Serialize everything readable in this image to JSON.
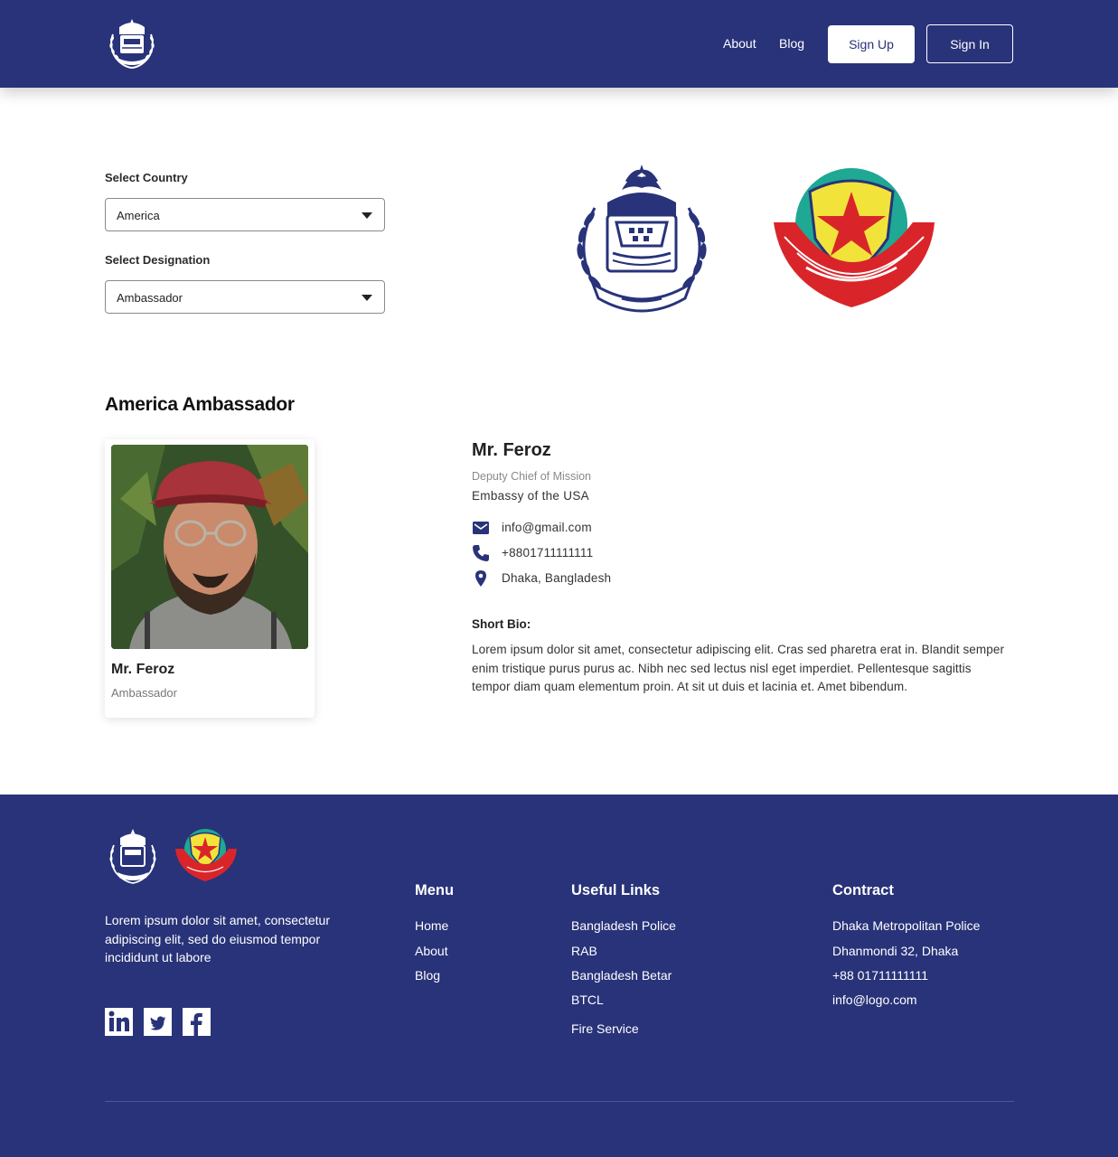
{
  "header": {
    "logo": "bangladesh-police-emblem",
    "nav": {
      "about": "About",
      "blog": "Blog"
    },
    "signup_label": "Sign Up",
    "signin_label": "Sign In"
  },
  "filters": {
    "country_label": "Select Country",
    "country_value": "America",
    "designation_label": "Select Designation",
    "designation_value": "Ambassador"
  },
  "emblems": [
    "bangladesh-police-emblem",
    "dhaka-metropolitan-police-emblem"
  ],
  "section_title": "America Ambassador",
  "card": {
    "name": "Mr. Feroz",
    "role": "Ambassador",
    "photo": "portrait-man-red-cap"
  },
  "detail": {
    "name": "Mr. Feroz",
    "title": "Deputy Chief of Mission",
    "organization": "Embassy of the USA",
    "email": "info@gmail.com",
    "phone": "+8801711111111",
    "location": "Dhaka, Bangladesh",
    "bio_label": "Short Bio:",
    "bio": "Lorem ipsum dolor sit amet, consectetur adipiscing elit. Cras sed pharetra erat in. Blandit semper enim tristique purus purus ac. Nibh nec sed lectus nisl eget imperdiet. Pellentesque sagittis tempor diam quam elementum proin. At sit ut duis et lacinia et. Amet bibendum."
  },
  "footer": {
    "about": "Lorem ipsum dolor sit amet, consectetur adipiscing elit, sed do eiusmod tempor incididunt ut labore",
    "social": [
      "linkedin-icon",
      "twitter-icon",
      "facebook-icon"
    ],
    "menu": {
      "heading": "Menu",
      "items": [
        "Home",
        "About",
        "Blog"
      ]
    },
    "useful_links": {
      "heading": "Useful Links",
      "items": [
        "Bangladesh Police",
        "RAB",
        "Bangladesh Betar",
        "BTCL",
        "Fire Service"
      ]
    },
    "contract": {
      "heading": "Contract",
      "items": [
        "Dhaka Metropolitan Police",
        "Dhanmondi 32, Dhaka",
        "+88 01711111111",
        "info@logo.com"
      ]
    }
  },
  "colors": {
    "brand": "#283379",
    "white": "#ffffff",
    "dmp_green": "#1fa894",
    "dmp_yellow": "#f2e33a",
    "dmp_red": "#d9252a"
  }
}
